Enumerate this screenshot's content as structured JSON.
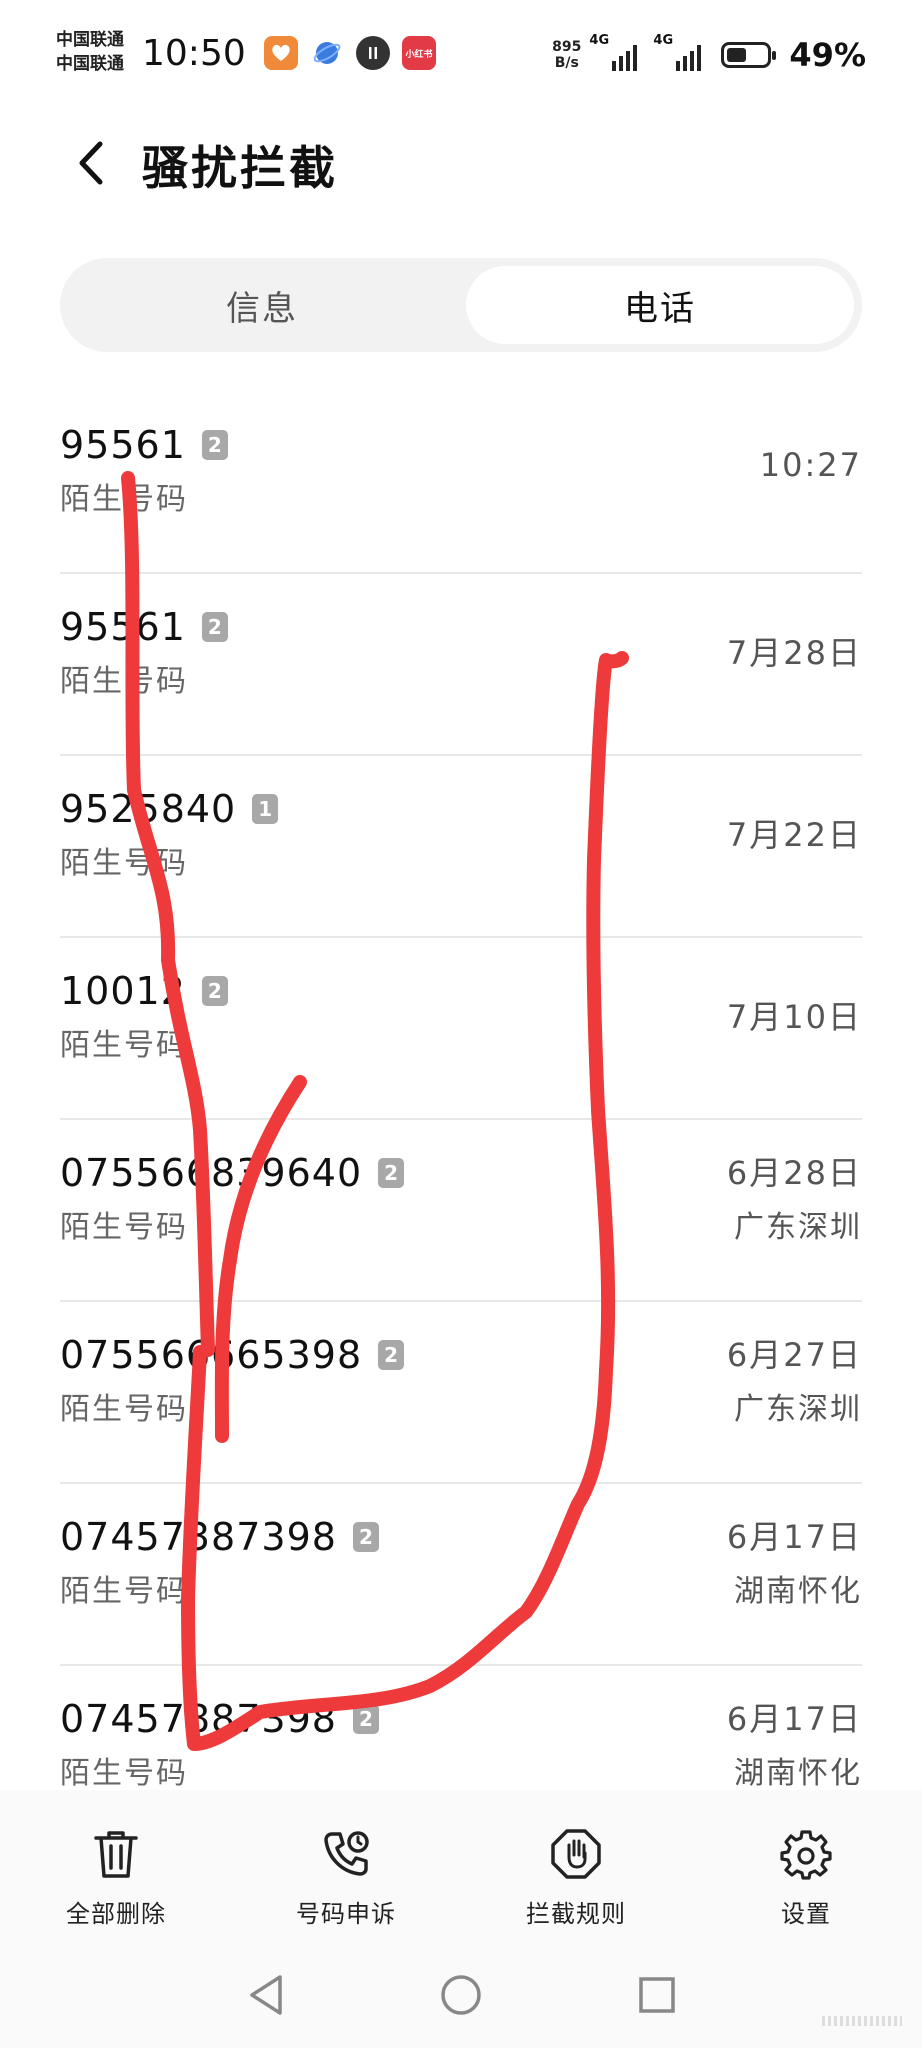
{
  "status_bar": {
    "carrier_1": "中国联通",
    "carrier_2": "中国联通",
    "time": "10:50",
    "net_speed_value": "895",
    "net_speed_unit": "B/s",
    "network_1": "4G",
    "network_2": "4G",
    "battery_percent": "49%",
    "battery_level": 0.49,
    "notification_icons": [
      "taobao-app-icon",
      "blue-app-icon",
      "black-app-icon",
      "xiaohongshu-app-icon"
    ],
    "xiaohongshu_text": "小红书"
  },
  "header": {
    "title": "骚扰拦截"
  },
  "tabs": [
    {
      "label": "信息",
      "active": false
    },
    {
      "label": "电话",
      "active": true
    }
  ],
  "calls": [
    {
      "number": "95561",
      "count": "2",
      "label": "陌生号码",
      "date": "10:27",
      "location": ""
    },
    {
      "number": "95561",
      "count": "2",
      "label": "陌生号码",
      "date": "7月28日",
      "location": ""
    },
    {
      "number": "9525840",
      "count": "1",
      "label": "陌生号码",
      "date": "7月22日",
      "location": ""
    },
    {
      "number": "10012",
      "count": "2",
      "label": "陌生号码",
      "date": "7月10日",
      "location": ""
    },
    {
      "number": "075566839640",
      "count": "2",
      "label": "陌生号码",
      "date": "6月28日",
      "location": "广东深圳"
    },
    {
      "number": "075566665398",
      "count": "2",
      "label": "陌生号码",
      "date": "6月27日",
      "location": "广东深圳"
    },
    {
      "number": "07457387398",
      "count": "2",
      "label": "陌生号码",
      "date": "6月17日",
      "location": "湖南怀化"
    },
    {
      "number": "07457887398",
      "count": "2",
      "label": "陌生号码",
      "date": "6月17日",
      "location": "湖南怀化"
    }
  ],
  "toolbar": {
    "delete_all": "全部删除",
    "appeal": "号码申诉",
    "rules": "拦截规则",
    "settings": "设置"
  },
  "colors": {
    "scribble": "#ee3a3a",
    "badge": "#a8a8a8",
    "segment_bg": "#f2f2f2"
  }
}
